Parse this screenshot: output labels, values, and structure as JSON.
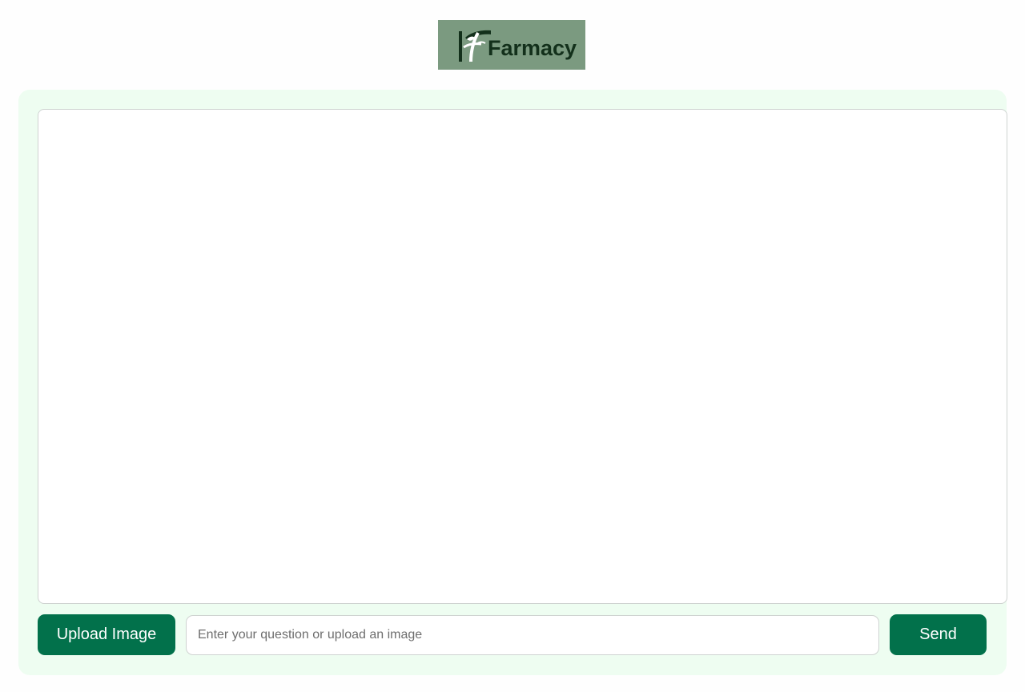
{
  "logo": {
    "text": "Farmacy",
    "background_color": "#7b9a80",
    "text_color": "#13301b",
    "icon": "leaf-sprout-icon"
  },
  "chat": {
    "messages": []
  },
  "composer": {
    "upload_label": "Upload Image",
    "input_value": "",
    "input_placeholder": "Enter your question or upload an image",
    "send_label": "Send"
  },
  "colors": {
    "accent": "#02714b",
    "panel_background": "#eefdf1"
  }
}
